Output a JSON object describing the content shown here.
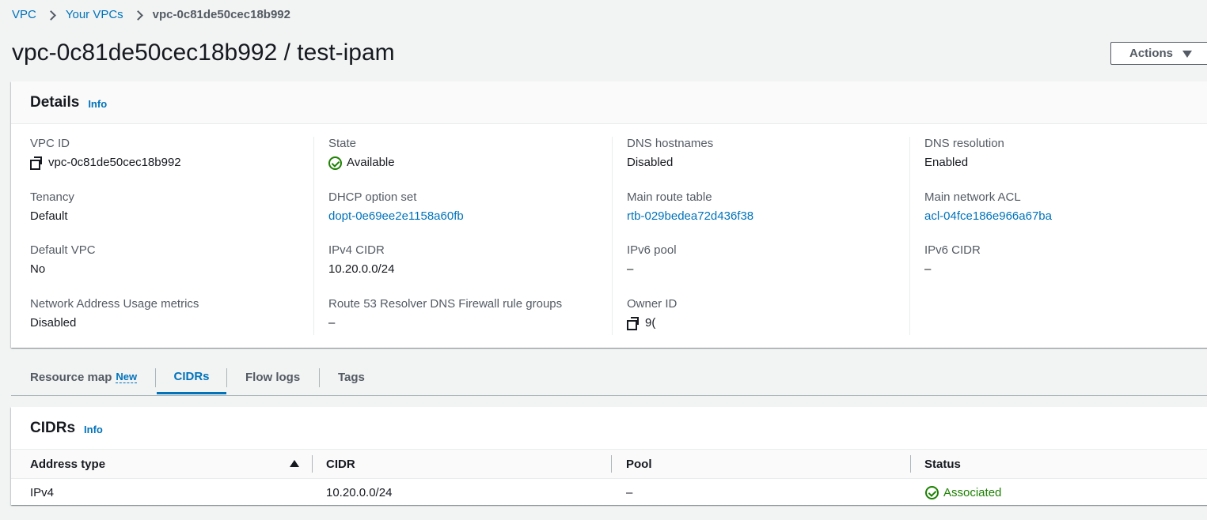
{
  "breadcrumb": {
    "items": [
      "VPC",
      "Your VPCs"
    ],
    "current": "vpc-0c81de50cec18b992"
  },
  "title": "vpc-0c81de50cec18b992 / test-ipam",
  "actions_label": "Actions",
  "details": {
    "heading": "Details",
    "info": "Info",
    "fields": {
      "vpc_id": {
        "label": "VPC ID",
        "value": "vpc-0c81de50cec18b992"
      },
      "state": {
        "label": "State",
        "value": "Available"
      },
      "dns_hostnames": {
        "label": "DNS hostnames",
        "value": "Disabled"
      },
      "dns_resolution": {
        "label": "DNS resolution",
        "value": "Enabled"
      },
      "tenancy": {
        "label": "Tenancy",
        "value": "Default"
      },
      "dhcp_option_set": {
        "label": "DHCP option set",
        "value": "dopt-0e69ee2e1158a60fb"
      },
      "main_route_table": {
        "label": "Main route table",
        "value": "rtb-029bedea72d436f38"
      },
      "main_network_acl": {
        "label": "Main network ACL",
        "value": "acl-04fce186e966a67ba"
      },
      "default_vpc": {
        "label": "Default VPC",
        "value": "No"
      },
      "ipv4_cidr": {
        "label": "IPv4 CIDR",
        "value": "10.20.0.0/24"
      },
      "ipv6_pool": {
        "label": "IPv6 pool",
        "value": "–"
      },
      "ipv6_cidr": {
        "label": "IPv6 CIDR",
        "value": "–"
      },
      "nau_metrics": {
        "label": "Network Address Usage metrics",
        "value": "Disabled"
      },
      "route53_fw": {
        "label": "Route 53 Resolver DNS Firewall rule groups",
        "value": "–"
      },
      "owner_id": {
        "label": "Owner ID",
        "value": "9("
      }
    }
  },
  "tabs": [
    {
      "label": "Resource map",
      "badge": "New"
    },
    {
      "label": "CIDRs"
    },
    {
      "label": "Flow logs"
    },
    {
      "label": "Tags"
    }
  ],
  "cidrs": {
    "heading": "CIDRs",
    "info": "Info",
    "columns": [
      "Address type",
      "CIDR",
      "Pool",
      "Status"
    ],
    "rows": [
      {
        "address_type": "IPv4",
        "cidr": "10.20.0.0/24",
        "pool": "–",
        "status": "Associated"
      }
    ]
  },
  "colors": {
    "link": "#0073bb",
    "success": "#1d8102",
    "background": "#f2f3f3"
  }
}
